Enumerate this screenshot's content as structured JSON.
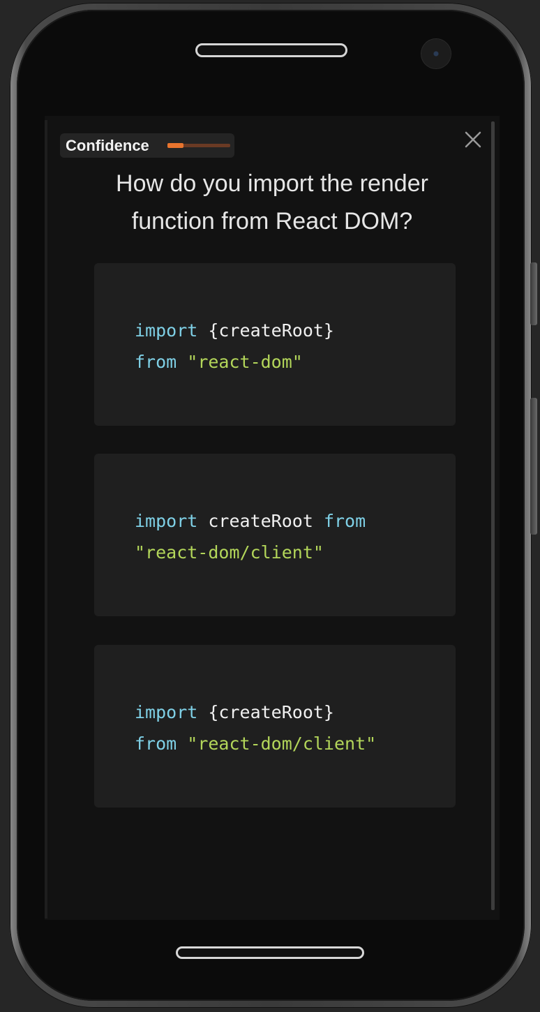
{
  "colors": {
    "keyword": "#7fd0e6",
    "string": "#b3d65a",
    "accent": "#e8742e"
  },
  "confidence": {
    "label": "Confidence",
    "level": 0.25
  },
  "close_icon": "close-icon",
  "question": {
    "line1": "How do you import the render",
    "line2": "function from React DOM?"
  },
  "options": [
    {
      "line1": {
        "kw1": "import",
        "plain1": " {createRoot}"
      },
      "line2": {
        "kw1": "from",
        "str1": " \"react-dom\""
      }
    },
    {
      "line1": {
        "kw1": "import",
        "plain1": " createRoot ",
        "kw2": "from"
      },
      "line2": {
        "str1": "\"react-dom/client\""
      }
    },
    {
      "line1": {
        "kw1": "import",
        "plain1": " {createRoot}"
      },
      "line2": {
        "kw1": "from",
        "str1": " \"react-dom/client\""
      }
    }
  ]
}
